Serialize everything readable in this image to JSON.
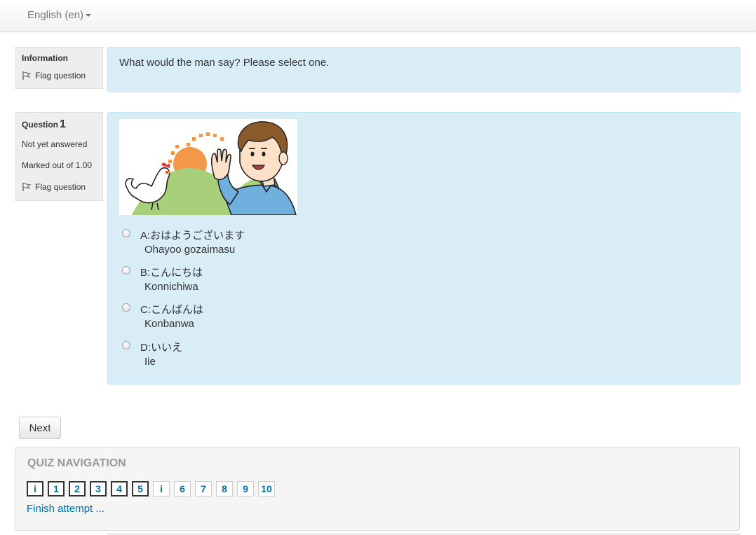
{
  "header": {
    "language_label": "English (en)"
  },
  "info_block": {
    "title": "Information",
    "flag_label": "Flag question",
    "text": "What would the man say?  Please select one."
  },
  "question": {
    "title": "Question",
    "number": "1",
    "status": "Not yet answered",
    "marks": "Marked out of 1.00",
    "flag_label": "Flag question",
    "answers": [
      {
        "line1": "A:おはようございます",
        "line2": "Ohayoo gozaimasu"
      },
      {
        "line1": "B:こんにちは",
        "line2": "Konnichiwa"
      },
      {
        "line1": "C:こんばんは",
        "line2": "Konbanwa"
      },
      {
        "line1": "D:いいえ",
        "line2": "Iie"
      }
    ]
  },
  "next_label": "Next",
  "quiz_nav": {
    "title": "QUIZ NAVIGATION",
    "buttons": [
      "i",
      "1",
      "2",
      "3",
      "4",
      "5",
      "i",
      "6",
      "7",
      "8",
      "9",
      "10"
    ],
    "finish_label": "Finish attempt ..."
  },
  "icons": {
    "flag": "flag-icon",
    "caret": "caret-down-icon"
  }
}
